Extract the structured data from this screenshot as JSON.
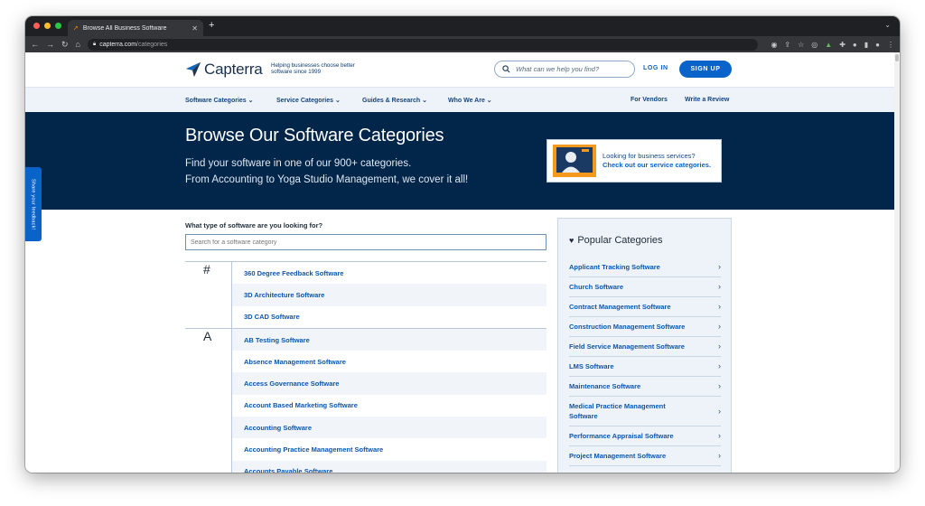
{
  "browser": {
    "tab_title": "Browse All Business Software",
    "url_domain": "capterra.com",
    "url_path": "/categories"
  },
  "header": {
    "logo_text": "Capterra",
    "tagline": "Helping businesses choose better software since 1999",
    "search_placeholder": "What can we help you find?",
    "login_label": "LOG IN",
    "signup_label": "SIGN UP"
  },
  "nav": {
    "items": [
      "Software Categories",
      "Service Categories",
      "Guides & Research",
      "Who We Are"
    ],
    "right": [
      "For Vendors",
      "Write a Review"
    ]
  },
  "hero": {
    "title": "Browse Our Software Categories",
    "line1": "Find your software in one of our 900+ categories.",
    "line2": "From Accounting to Yoga Studio Management, we cover it all!",
    "card_line1": "Looking for business services?",
    "card_link": "Check out our service categories."
  },
  "finder": {
    "label": "What type of software are you looking for?",
    "placeholder": "Search for a software category"
  },
  "categories": {
    "hash_letter": "#",
    "hash_items": [
      "360 Degree Feedback Software",
      "3D Architecture Software",
      "3D CAD Software"
    ],
    "a_letter": "A",
    "a_items": [
      "AB Testing Software",
      "Absence Management Software",
      "Access Governance Software",
      "Account Based Marketing Software",
      "Accounting Software",
      "Accounting Practice Management Software",
      "Accounts Payable Software"
    ]
  },
  "popular": {
    "title": "Popular Categories",
    "items": [
      "Applicant Tracking Software",
      "Church Software",
      "Contract Management Software",
      "Construction Management Software",
      "Field Service Management Software",
      "LMS Software",
      "Maintenance Software",
      "Medical Practice Management Software",
      "Performance Appraisal Software",
      "Project Management Software"
    ]
  },
  "feedback_tab": "Share your feedback!",
  "colors": {
    "brand_dark": "#02254a",
    "link_blue": "#0a63c9",
    "logo_orange": "#ff8a00"
  }
}
